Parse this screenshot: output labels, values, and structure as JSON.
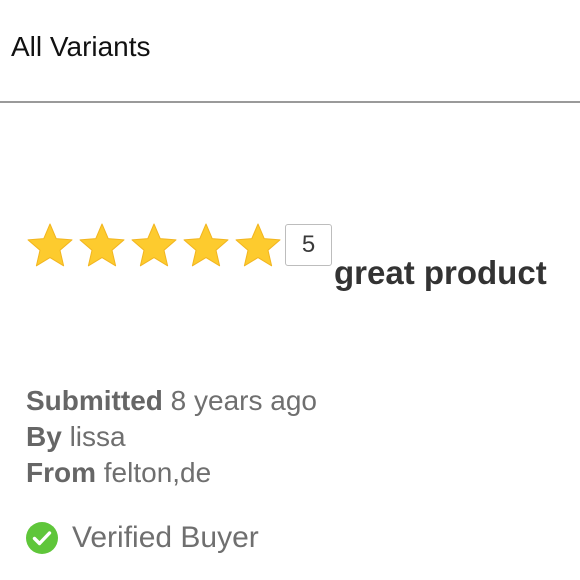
{
  "filter": {
    "label": "All Variants"
  },
  "review": {
    "rating": 5,
    "rating_max": 5,
    "rating_label": "5",
    "title": "great product",
    "submitted_label": "Submitted",
    "submitted_value": "8 years ago",
    "by_label": "By",
    "by_value": "lissa",
    "from_label": "From",
    "from_value": "felton,de",
    "verified_label": "Verified Buyer"
  },
  "icons": {
    "star": "star-icon",
    "verified": "check-circle-icon"
  },
  "colors": {
    "star_fill": "#FDCB2E",
    "verified_green": "#5FC63A"
  }
}
